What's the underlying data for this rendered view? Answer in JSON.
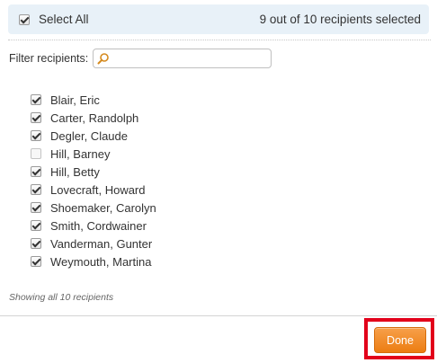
{
  "select_all": {
    "label": "Select All",
    "checked": true,
    "count_text": "9 out of 10 recipients selected"
  },
  "filter": {
    "label": "Filter recipients:",
    "value": "",
    "icon": "search-icon"
  },
  "recipients": [
    {
      "name": "Blair, Eric",
      "checked": true
    },
    {
      "name": "Carter, Randolph",
      "checked": true
    },
    {
      "name": "Degler, Claude",
      "checked": true
    },
    {
      "name": "Hill, Barney",
      "checked": false
    },
    {
      "name": "Hill, Betty",
      "checked": true
    },
    {
      "name": "Lovecraft, Howard",
      "checked": true
    },
    {
      "name": "Shoemaker, Carolyn",
      "checked": true
    },
    {
      "name": "Smith, Cordwainer",
      "checked": true
    },
    {
      "name": "Vanderman, Gunter",
      "checked": true
    },
    {
      "name": "Weymouth, Martina",
      "checked": true
    }
  ],
  "showing_text": "Showing all 10 recipients",
  "footer": {
    "done_label": "Done"
  },
  "colors": {
    "accent_orange": "#ec7d12",
    "highlight_red": "#e2001a",
    "select_bar_bg": "#e8f1f8"
  }
}
